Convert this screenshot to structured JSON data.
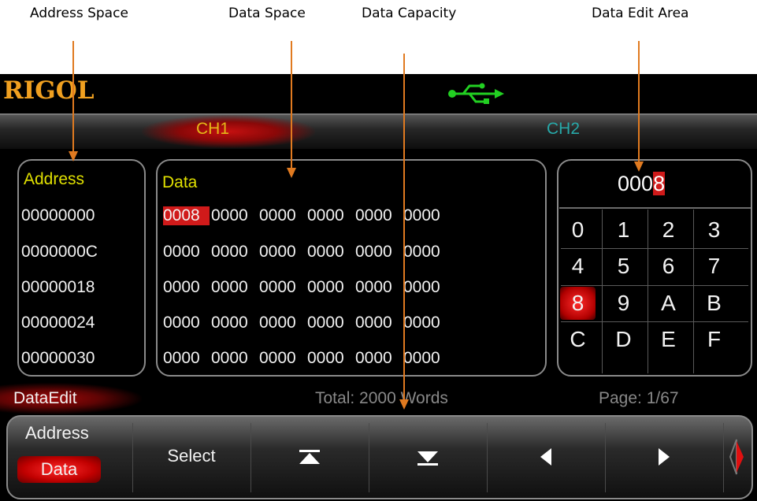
{
  "callouts": {
    "address_space": "Address Space",
    "data_space": "Data Space",
    "data_capacity": "Data Capacity",
    "data_edit_area": "Data Edit Area"
  },
  "header": {
    "logo": "RIGOL",
    "usb_icon": "usb-icon",
    "usb_color": "#22d022"
  },
  "channels": [
    {
      "label": "CH1",
      "active": true,
      "color": "#e4b818"
    },
    {
      "label": "CH2",
      "active": false,
      "color": "#27a8a8"
    }
  ],
  "address_panel": {
    "title": "Address",
    "rows": [
      "00000000",
      "0000000C",
      "00000018",
      "00000024",
      "00000030"
    ]
  },
  "data_panel": {
    "title": "Data",
    "rows": [
      [
        "0008",
        "0000",
        "0000",
        "0000",
        "0000",
        "0000"
      ],
      [
        "0000",
        "0000",
        "0000",
        "0000",
        "0000",
        "0000"
      ],
      [
        "0000",
        "0000",
        "0000",
        "0000",
        "0000",
        "0000"
      ],
      [
        "0000",
        "0000",
        "0000",
        "0000",
        "0000",
        "0000"
      ],
      [
        "0000",
        "0000",
        "0000",
        "0000",
        "0000",
        "0000"
      ]
    ]
  },
  "edit_area": {
    "value_prefix": "000",
    "value_cursor": "8",
    "keys": [
      "0",
      "1",
      "2",
      "3",
      "4",
      "5",
      "6",
      "7",
      "8",
      "9",
      "A",
      "B",
      "C",
      "D",
      "E",
      "F"
    ],
    "selected_key": "8"
  },
  "status": {
    "mode": "DataEdit",
    "total": "Total: 2000 Words",
    "page": "Page: 1/67"
  },
  "menu": {
    "address_label": "Address",
    "data_label": "Data",
    "select_label": "Select",
    "buttons": [
      "first-page-icon",
      "last-page-icon",
      "left-arrow-icon",
      "right-arrow-icon"
    ],
    "more_icon": "next-menu-icon"
  },
  "colors": {
    "accent_red": "#d01a1a",
    "title_yellow": "#e0e000",
    "callout_arrow": "#e07a20"
  }
}
